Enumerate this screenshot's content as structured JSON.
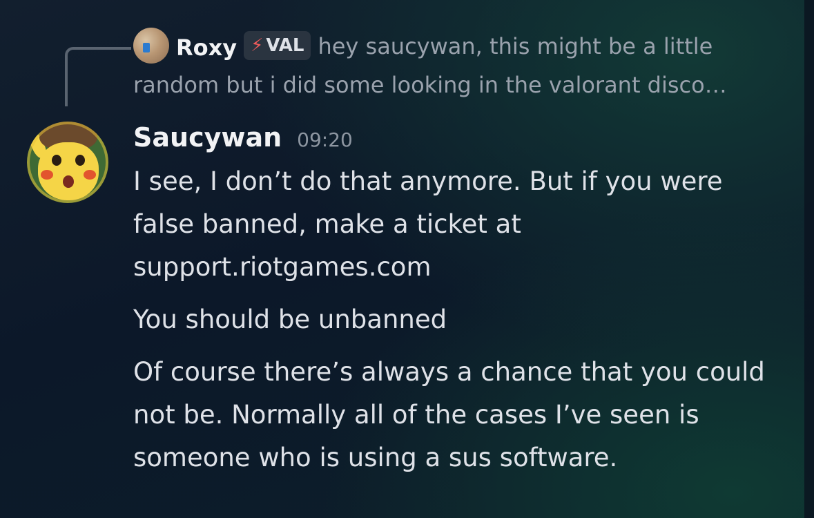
{
  "reply": {
    "author": "Roxy",
    "tag": "VAL",
    "tag_icon": "lightning-icon",
    "preview": "hey saucywan, this might be a little random but i did some looking in the valorant disco…"
  },
  "message": {
    "author": "Saucywan",
    "timestamp": "09:20",
    "paragraphs": [
      "I see, I don’t do that anymore. But if you were false banned, make a ticket at support.riotgames.com",
      "You should be unbanned",
      "Of course there’s always a chance that you could not be. Normally all of the cases I’ve seen is someone who is using a sus software."
    ]
  },
  "colors": {
    "background": "#0c1829",
    "text": "#dfe2e8",
    "muted": "#9aa2ad",
    "bolt": "#ef5b5b"
  }
}
